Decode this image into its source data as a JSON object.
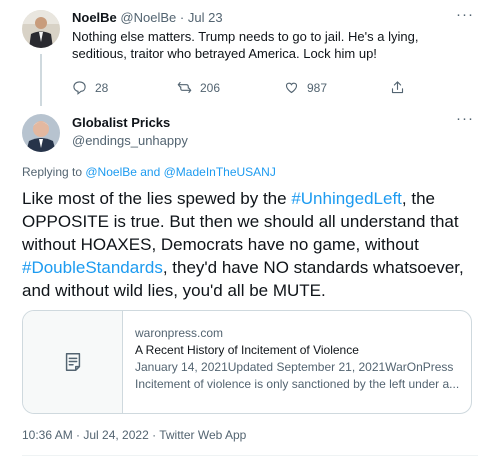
{
  "reply_parent": {
    "author_name": "NoelBe",
    "author_handle": "@NoelBe",
    "separator": "·",
    "date": "Jul 23",
    "more": "···",
    "text": "Nothing else matters. Trump needs to go to jail. He's a lying, seditious, traitor who betrayed America. Lock him up!",
    "replies": "28",
    "retweets": "206",
    "likes": "987",
    "icons": [
      "reply-icon",
      "retweet-icon",
      "like-icon",
      "share-icon"
    ]
  },
  "tweet": {
    "author_name": "Globalist Pricks",
    "author_handle": "@endings_unhappy",
    "more": "···",
    "replying_prefix": "Replying to ",
    "replying_user1": "@NoelBe",
    "replying_and": " and ",
    "replying_user2": "@MadeInTheUSANJ",
    "text_parts": {
      "p1": "Like most of the lies spewed by the ",
      "h1": "#UnhingedLeft",
      "p2": ", the OPPOSITE is true. But then we should all understand that without HOAXES, Democrats have no game, without ",
      "h2": "#DoubleStandards",
      "p3": ", they'd have NO standards whatsoever, and without wild lies, you'd all be MUTE."
    },
    "card": {
      "domain": "waronpress.com",
      "title": "A Recent History of Incitement of Violence",
      "meta": "January 14, 2021Updated September 21, 2021WarOnPress",
      "description": "Incitement of violence is only sanctioned by the left under a...",
      "icon": "article-icon"
    },
    "timestamp": "10:36 AM · Jul 24, 2022 · Twitter Web App"
  },
  "colors": {
    "accent": "#1d9bf0",
    "text": "#0f1419",
    "secondary": "#536471",
    "border": "#cfd9de"
  }
}
